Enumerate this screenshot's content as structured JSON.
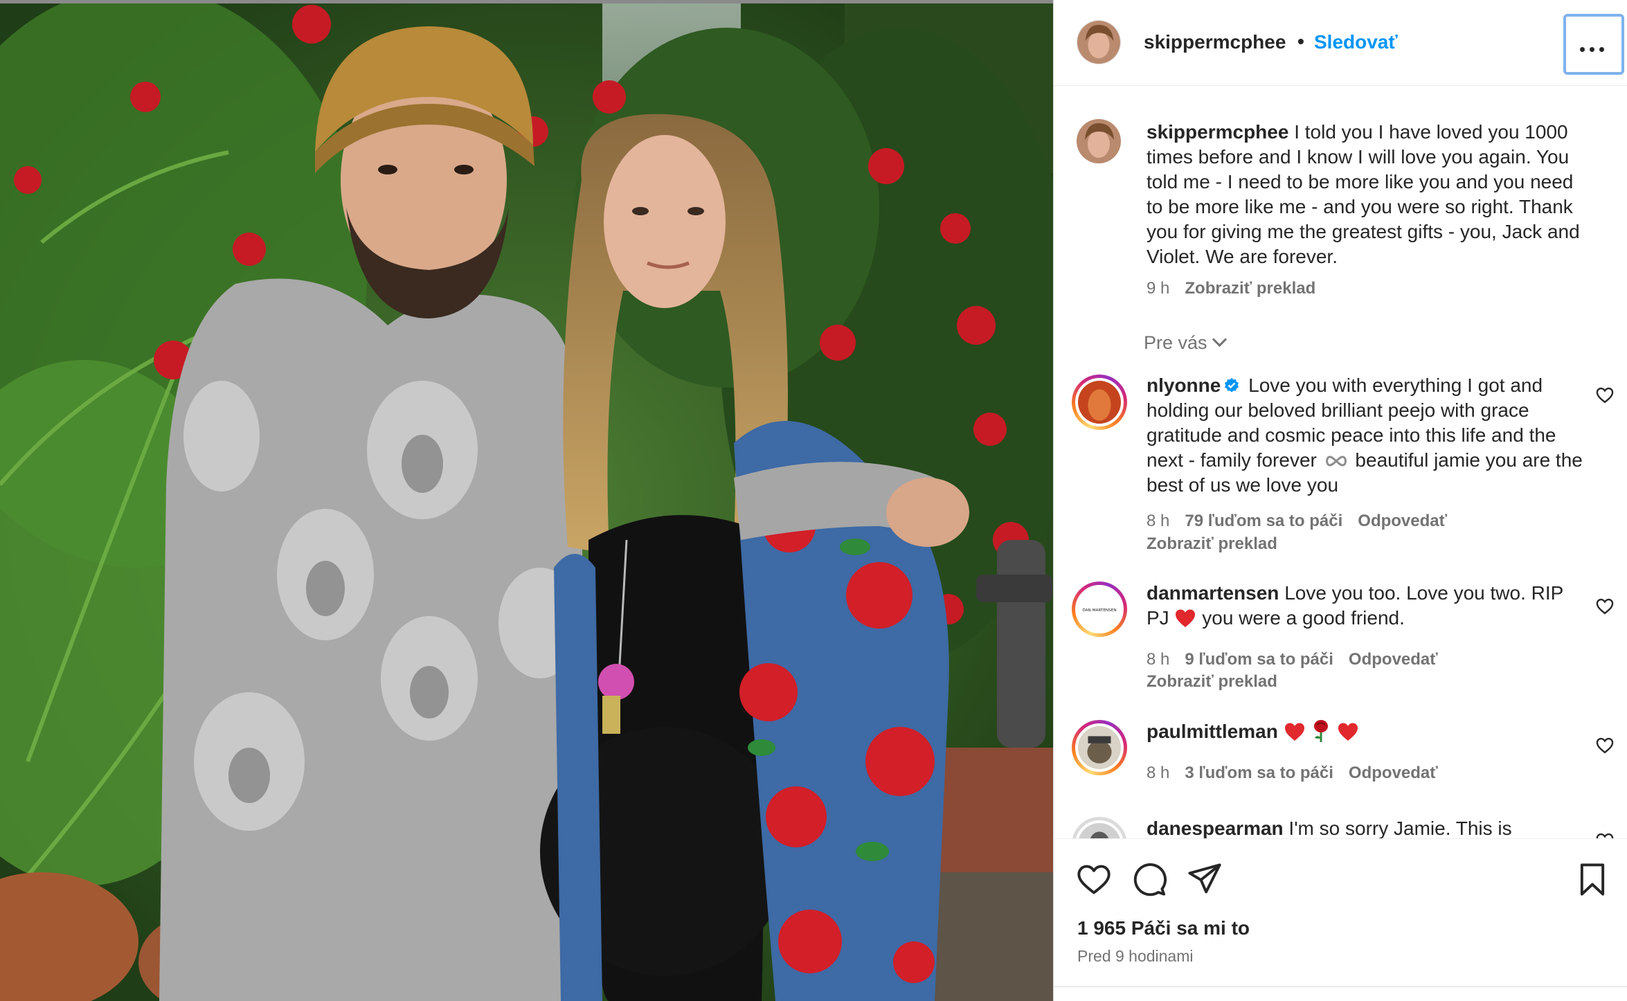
{
  "post": {
    "username": "skippermcphee",
    "separator": "•",
    "follow_label": "Sledovať",
    "more_icon": "more-horizontal-icon"
  },
  "caption": {
    "username": "skippermcphee",
    "lines": [
      "I told you I have loved you 1000",
      "times before and I know I will love you again. You",
      "told me - I need to be more like you and you need to",
      "be more like me - and you were so right. Thank you",
      "for giving me the greatest gifts - you, Jack and",
      "Violet. We are forever."
    ],
    "time": "9 h",
    "translate": "Zobraziť preklad"
  },
  "filter_label": "Pre vás",
  "comments": [
    {
      "username": "nlyonne",
      "verified": true,
      "lines": [
        "Love you with everything I got and",
        "holding our beloved brilliant peejo with grace",
        "gratitude and cosmic peace into this life and",
        "the next - family forever",
        "beautiful jamie you",
        "are the best of us we love you"
      ],
      "time": "8 h",
      "likes": "79 ľuďom sa to páči",
      "reply": "Odpovedať",
      "translate": "Zobraziť preklad"
    },
    {
      "username": "danmartensen",
      "avatar_text": "DAN MARTENSEN",
      "lines": [
        "Love you too. Love you two. RIP",
        "PJ",
        "you were a good friend."
      ],
      "time": "8 h",
      "likes": "9 ľuďom sa to páči",
      "reply": "Odpovedať",
      "translate": "Zobraziť preklad"
    },
    {
      "username": "paulmittleman",
      "time": "8 h",
      "likes": "3 ľuďom sa to páči",
      "reply": "Odpovedať"
    },
    {
      "username": "danespearman",
      "lines": [
        "I'm so sorry Jamie. This is"
      ]
    }
  ],
  "footer": {
    "likes": "1 965 Páči sa mi to",
    "time": "Pred 9 hodinami",
    "icons": [
      "heart-icon",
      "comment-icon",
      "share-icon",
      "bookmark-icon"
    ]
  },
  "colors": {
    "link_blue": "#0095f6",
    "text": "#262626",
    "secondary": "#737373",
    "emoji_red": "#e0282d",
    "focus_ring": "#7fb2ec"
  }
}
